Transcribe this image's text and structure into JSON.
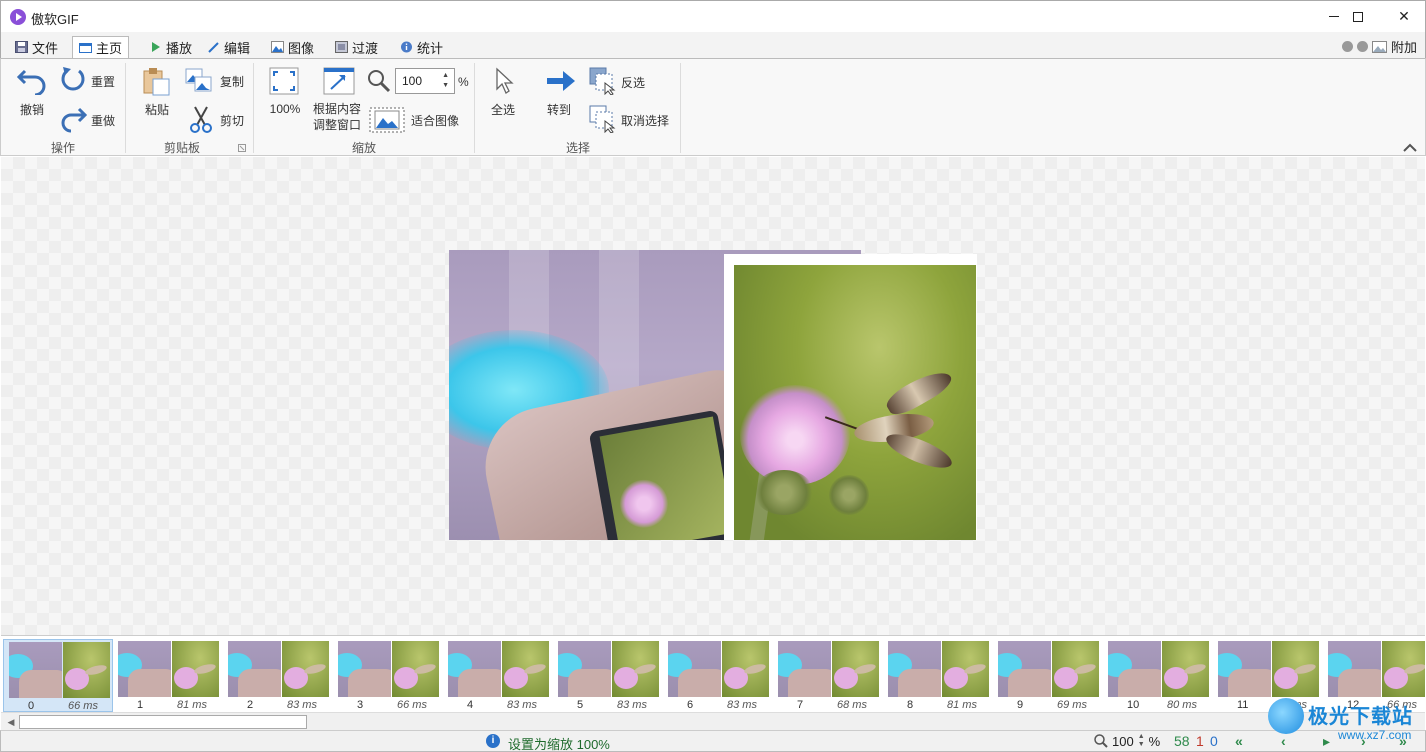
{
  "window": {
    "title": "傲软GIF"
  },
  "tabs": [
    {
      "label": "文件",
      "icon": "save-icon"
    },
    {
      "label": "主页",
      "icon": "home-icon",
      "active": true
    },
    {
      "label": "播放",
      "icon": "play-icon"
    },
    {
      "label": "编辑",
      "icon": "pencil-icon"
    },
    {
      "label": "图像",
      "icon": "image-icon"
    },
    {
      "label": "过渡",
      "icon": "transition-icon"
    },
    {
      "label": "统计",
      "icon": "info-icon"
    }
  ],
  "right_tools": {
    "attach_label": "附加"
  },
  "ribbon": {
    "operations": {
      "undo": "撤销",
      "redo_reset": "重置",
      "redo": "重做",
      "group": "操作"
    },
    "clipboard": {
      "paste": "粘贴",
      "copy": "复制",
      "cut": "剪切",
      "group": "剪贴板"
    },
    "zoom": {
      "hundred": "100%",
      "fit_content_1": "根据内容",
      "fit_content_2": "调整窗口",
      "zoom_value": "100",
      "percent": "%",
      "fit_image": "适合图像",
      "group": "缩放"
    },
    "select": {
      "select_all": "全选",
      "goto": "转到",
      "invert": "反选",
      "deselect": "取消选择",
      "group": "选择"
    }
  },
  "frames": [
    {
      "index": "0",
      "duration": "66 ms",
      "selected": true
    },
    {
      "index": "1",
      "duration": "81 ms"
    },
    {
      "index": "2",
      "duration": "83 ms"
    },
    {
      "index": "3",
      "duration": "66 ms"
    },
    {
      "index": "4",
      "duration": "83 ms"
    },
    {
      "index": "5",
      "duration": "83 ms"
    },
    {
      "index": "6",
      "duration": "83 ms"
    },
    {
      "index": "7",
      "duration": "68 ms"
    },
    {
      "index": "8",
      "duration": "81 ms"
    },
    {
      "index": "9",
      "duration": "69 ms"
    },
    {
      "index": "10",
      "duration": "80 ms"
    },
    {
      "index": "11",
      "duration": "85 ms"
    },
    {
      "index": "12",
      "duration": "66 ms"
    }
  ],
  "status": {
    "message": "设置为缩放 100%",
    "zoom_value": "100",
    "percent": "%",
    "count_total": "58",
    "count_selected": "1",
    "count_current": "0"
  },
  "watermark": {
    "line1": "极光下载站",
    "line2": "www.xz7.com"
  },
  "colors": {
    "accent": "#2a71c9",
    "status_green": "#1e6a2c",
    "selection": "#d4e6f7"
  }
}
